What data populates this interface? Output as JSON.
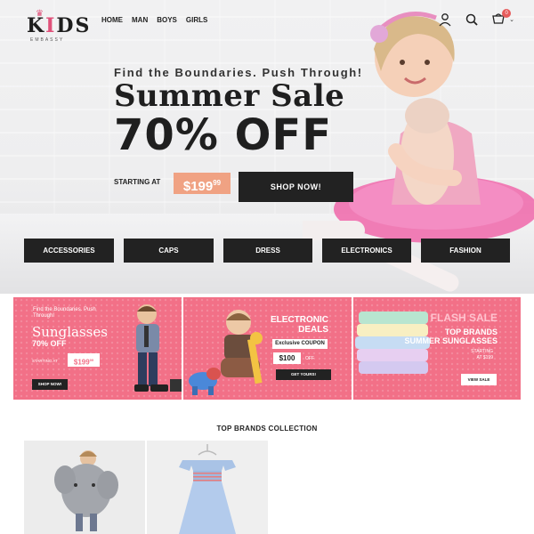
{
  "header": {
    "logo_text": "KIDS",
    "logo_sub": "EMBASSY",
    "nav": [
      "HOME",
      "MAN",
      "BOYS",
      "GIRLS"
    ],
    "cart_count": "0"
  },
  "hero": {
    "tagline": "Find the Boundaries. Push Through!",
    "title_line1": "Summer Sale",
    "title_line2": "70% OFF",
    "starting_label": "STARTING AT",
    "price": "$199",
    "price_cents": "99",
    "shop_button": "SHOP NOW!"
  },
  "categories": [
    "ACCESSORIES",
    "CAPS",
    "DRESS",
    "ELECTRONICS",
    "FASHION"
  ],
  "promos": {
    "p1": {
      "tag": "Find the Boundaries. Push Through!",
      "title": "Sunglasses",
      "subtitle": "70% OFF",
      "starting": "STARTING AT",
      "price": "$199",
      "price_cents": "99",
      "button": "SHOP NOW!"
    },
    "p2": {
      "title_line1": "ELECTRONIC",
      "title_line2": "DEALS",
      "coupon": "Exclusive COUPON",
      "amount": "$100",
      "off": "OFF",
      "button": "GET YOURS!"
    },
    "p3": {
      "flash": "FLASH SALE",
      "title_line1": "TOP BRANDS",
      "title_line2": "SUMMER SUNGLASSES",
      "starting": "STARTING",
      "price": "AT $199",
      "button": "VIEW SALE"
    }
  },
  "collection": {
    "title": "TOP BRANDS COLLECTION"
  },
  "colors": {
    "accent": "#f27087",
    "dark": "#222222",
    "price_tag": "#f0a283"
  }
}
